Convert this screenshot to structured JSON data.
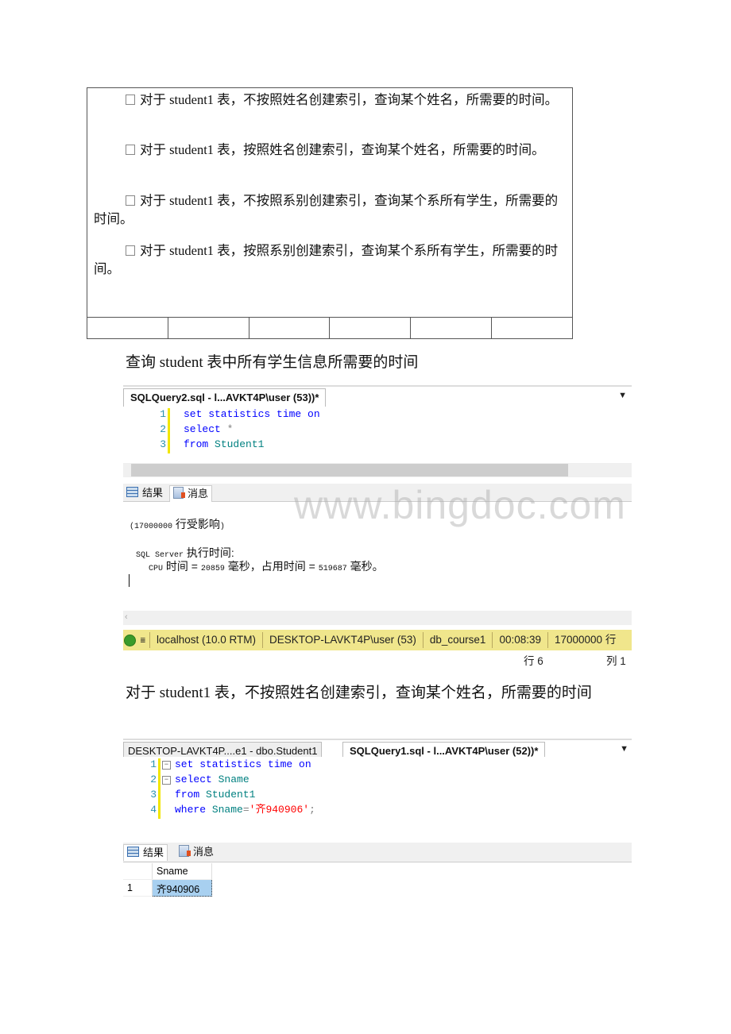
{
  "task_box": {
    "paragraphs": [
      "对于 student1 表，不按照姓名创建索引，查询某个姓名，所需要的时间。",
      "对于 student1 表，按照姓名创建索引，查询某个姓名，所需要的时间。",
      "对于 student1 表，不按照系别创建索引，查询某个系所有学生，所需要的时间。",
      "对于 student1 表，按照系别创建索引，查询某个系所有学生，所需要的时间。"
    ]
  },
  "heading1": "查询 student 表中所有学生信息所需要的时间",
  "screenshot1": {
    "tab_title": "SQLQuery2.sql - l...AVKT4P\\user (53))*",
    "code": [
      {
        "num": "1",
        "parts": [
          {
            "t": "set statistics time on",
            "c": "kw"
          }
        ]
      },
      {
        "num": "2",
        "parts": [
          {
            "t": "select ",
            "c": "kw"
          },
          {
            "t": "*",
            "c": "gray"
          }
        ]
      },
      {
        "num": "3",
        "parts": [
          {
            "t": "from ",
            "c": "kw"
          },
          {
            "t": "Student1",
            "c": "id"
          }
        ]
      }
    ],
    "results_tab": "结果",
    "messages_tab": "消息",
    "messages": {
      "rows_affected_num": "(17000000",
      "rows_affected_text": " 行受影响",
      "rows_affected_close": ")",
      "sql_server_label": "SQL Server",
      "exec_time_label": " 执行时间:",
      "cpu_label": "CPU",
      "cpu_time_text": " 时间 = ",
      "cpu_ms": "20859",
      "ms_unit": " 毫秒，占用时间 = ",
      "elapsed_ms": "519687",
      "ms_end": " 毫秒。"
    },
    "watermark": "www.bingdoc.com",
    "status": {
      "server": "localhost (10.0 RTM)",
      "user": "DESKTOP-LAVKT4P\\user (53)",
      "database": "db_course1",
      "elapsed": "00:08:39",
      "rows": "17000000 行"
    },
    "position": {
      "row": "行 6",
      "col": "列 1"
    }
  },
  "heading2": "对于 student1 表，不按照姓名创建索引，查询某个姓名，所需要的时间",
  "screenshot2": {
    "inactive_tab": "DESKTOP-LAVKT4P....e1 - dbo.Student1",
    "active_tab": "SQLQuery1.sql - l...AVKT4P\\user (52))*",
    "code": [
      {
        "num": "1",
        "parts": [
          {
            "t": "set statistics time on",
            "c": "kw"
          }
        ]
      },
      {
        "num": "2",
        "parts": [
          {
            "t": "select ",
            "c": "kw"
          },
          {
            "t": "Sname",
            "c": "id"
          }
        ]
      },
      {
        "num": "3",
        "parts": [
          {
            "t": "from ",
            "c": "kw"
          },
          {
            "t": "Student1",
            "c": "id"
          }
        ]
      },
      {
        "num": "4",
        "parts": [
          {
            "t": "where ",
            "c": "kw"
          },
          {
            "t": "Sname",
            "c": "id"
          },
          {
            "t": "=",
            "c": "gray"
          },
          {
            "t": "'齐940906'",
            "c": "str"
          },
          {
            "t": ";",
            "c": "gray"
          }
        ]
      }
    ],
    "results_tab": "结果",
    "messages_tab": "消息",
    "grid": {
      "columns": [
        "Sname"
      ],
      "rows": [
        {
          "num": "1",
          "cells": [
            "齐940906"
          ]
        }
      ]
    }
  },
  "colors": {
    "keyword": "#0000ff",
    "identifier": "#008080",
    "string": "#ff0000",
    "statusbar": "#f0e68c",
    "selected_cell": "#a8d0f0"
  }
}
